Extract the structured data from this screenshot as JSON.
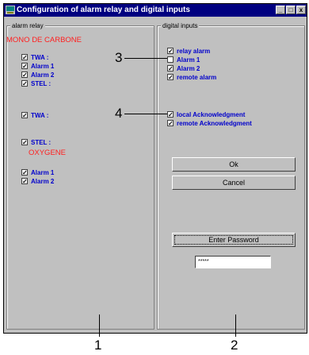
{
  "window": {
    "title": "Configuration of alarm relay and digital inputs"
  },
  "controls": {
    "minimize": "_",
    "maximize": "□",
    "close": "x"
  },
  "alarm_relay": {
    "legend": "alarm relay",
    "co_title": "MONO DE CARBONE",
    "co_items": [
      {
        "label": "TWA :",
        "checked": true
      },
      {
        "label": "Alarm 1",
        "checked": true
      },
      {
        "label": "Alarm 2",
        "checked": true
      },
      {
        "label": "STEL :",
        "checked": true
      }
    ],
    "twa2": {
      "label": "TWA :",
      "checked": true
    },
    "stel2": {
      "label": "STEL :",
      "checked": true
    },
    "o2_title": "OXYGENE",
    "o2_items": [
      {
        "label": "Alarm 1",
        "checked": true
      },
      {
        "label": "Alarm 2",
        "checked": true
      }
    ]
  },
  "digital_inputs": {
    "legend": "digital inputs",
    "alarms": [
      {
        "label": "relay alarm",
        "checked": true
      },
      {
        "label": "Alarm 1",
        "checked": false
      },
      {
        "label": "Alarm 2",
        "checked": true
      },
      {
        "label": "remote alarm",
        "checked": true
      }
    ],
    "acks": [
      {
        "label": "local Acknowledgment",
        "checked": true
      },
      {
        "label": "remote Acknowledgment",
        "checked": true
      }
    ]
  },
  "buttons": {
    "ok": "Ok",
    "cancel": "Cancel",
    "enter_password": "Enter Password"
  },
  "password": {
    "value": "*****"
  },
  "callouts": {
    "c1": "1",
    "c2": "2",
    "c3": "3",
    "c4": "4"
  }
}
